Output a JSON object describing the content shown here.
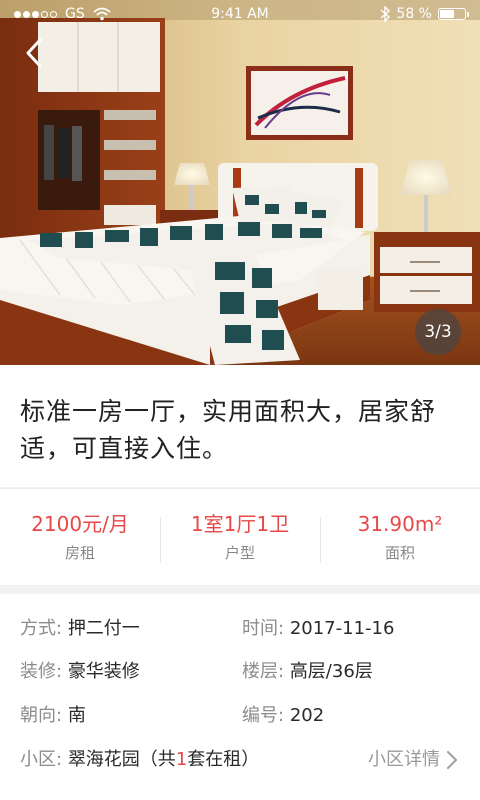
{
  "status_bar": {
    "carrier": "GS",
    "time": "9:41 AM",
    "battery": "58 %",
    "battery_level": 0.58
  },
  "gallery": {
    "counter": "3/3"
  },
  "listing": {
    "title": "标准一房一厅，实用面积大，居家舒适，可直接入住。"
  },
  "stats": [
    {
      "value": "2100元/月",
      "label": "房租"
    },
    {
      "value": "1室1厅1卫",
      "label": "户型"
    },
    {
      "value": "31.90m²",
      "label": "面积"
    }
  ],
  "details": {
    "payment": {
      "label": "方式:",
      "value": "押二付一"
    },
    "time": {
      "label": "时间:",
      "value": "2017-11-16"
    },
    "decoration": {
      "label": "装修:",
      "value": "豪华装修"
    },
    "floor": {
      "label": "楼层:",
      "value": "高层/36层"
    },
    "orientation": {
      "label": "朝向:",
      "value": "南"
    },
    "number": {
      "label": "编号:",
      "value": "202"
    },
    "community": {
      "label": "小区:",
      "name_prefix": "翠海花园（共",
      "count": "1",
      "name_suffix": "套在租）",
      "link": "小区详情"
    }
  },
  "colors": {
    "accent": "#e84848",
    "label": "#8c8c8c"
  }
}
